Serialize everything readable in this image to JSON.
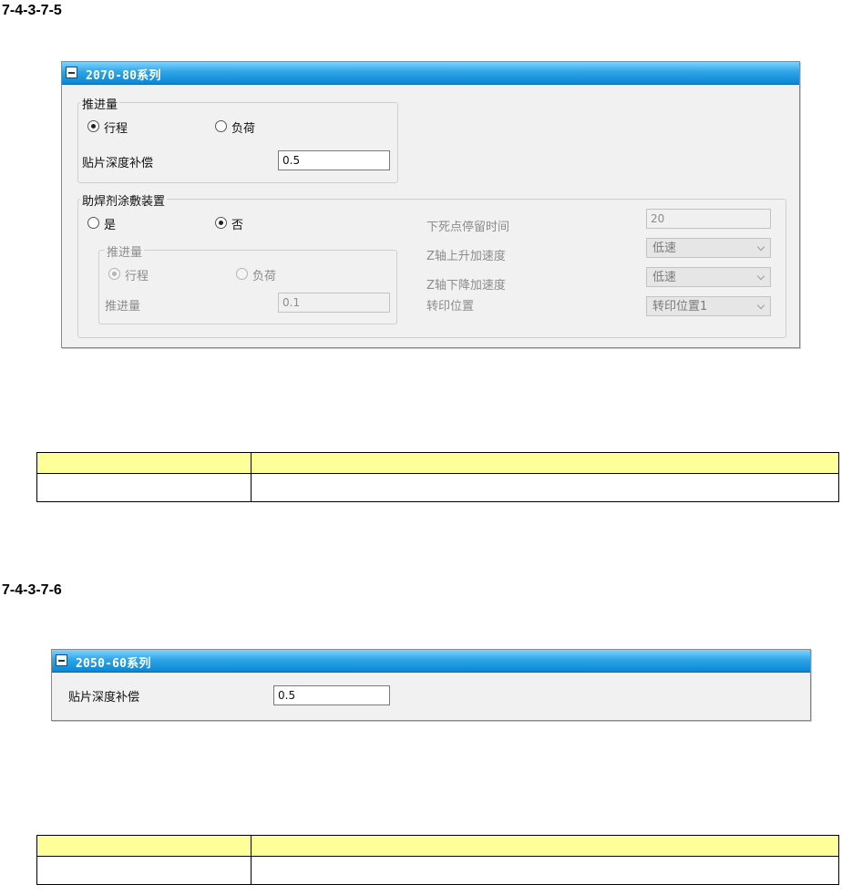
{
  "section1": {
    "heading": "7-4-3-7-5",
    "panel_title": "2070-80系列",
    "feed_group": {
      "legend": "推进量",
      "option_stroke": "行程",
      "option_load": "负荷",
      "selected": "行程",
      "depth_label": "贴片深度补偿",
      "depth_value": "0.5"
    },
    "flux_group": {
      "legend": "助焊剂涂敷装置",
      "option_yes": "是",
      "option_no": "否",
      "selected": "否",
      "sub_group": {
        "legend": "推进量",
        "option_stroke": "行程",
        "option_load": "负荷",
        "selected": "行程",
        "feed_label": "推进量",
        "feed_value": "0.1"
      },
      "dwell_label": "下死点停留时间",
      "dwell_value": "20",
      "z_up_label": "Z轴上升加速度",
      "z_up_value": "低速",
      "z_down_label": "Z轴下降加速度",
      "z_down_value": "低速",
      "transfer_label": "转印位置",
      "transfer_value": "转印位置1"
    }
  },
  "section2": {
    "heading": "7-4-3-7-6",
    "panel_title": "2050-60系列",
    "depth_label": "贴片深度补偿",
    "depth_value": "0.5"
  },
  "tables": [
    {
      "header": [
        "",
        ""
      ],
      "row": [
        "",
        ""
      ]
    },
    {
      "header": [
        "",
        ""
      ],
      "row": [
        "",
        ""
      ]
    }
  ],
  "colors": {
    "header_blue": "#0a86d6",
    "table_header_yellow": "#ffff99",
    "panel_bg": "#f1f1f1"
  }
}
